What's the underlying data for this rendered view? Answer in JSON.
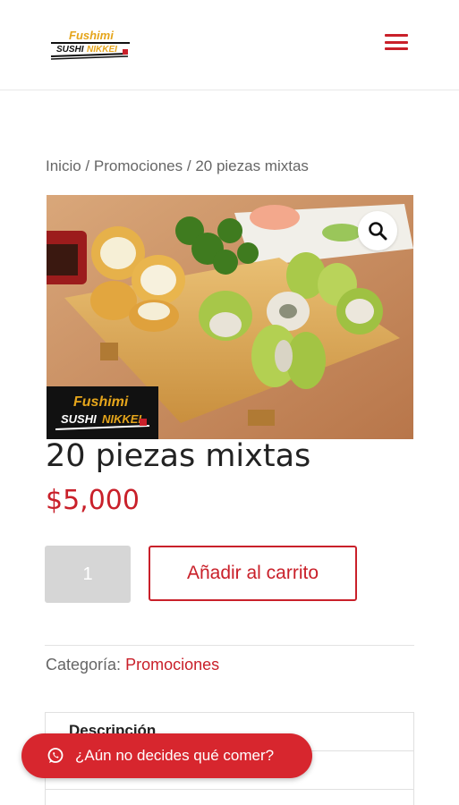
{
  "header": {
    "logo_text_top": "Fushimi",
    "logo_text_bottom": "SUSHI NIKKEI",
    "menu_icon": "hamburger-menu-icon"
  },
  "breadcrumb": {
    "home": "Inicio",
    "separator": "/",
    "category": "Promociones",
    "current": "20 piezas mixtas"
  },
  "product": {
    "title": "20 piezas mixtas",
    "price": "$5,000",
    "zoom_icon": "magnifier-icon",
    "image_watermark_top": "Fushimi",
    "image_watermark_bottom": "SUSHI NIKKEI",
    "quantity": "1",
    "add_to_cart_label": "Añadir al carrito",
    "category_label": "Categoría:",
    "category_value": "Promociones"
  },
  "tabs": {
    "description_label": "Descripción"
  },
  "chat": {
    "icon": "whatsapp-icon",
    "label": "¿Aún no decides qué comer?"
  },
  "colors": {
    "accent": "#c9202a",
    "chat_bg": "#d7262e",
    "qty_bg": "#d6d6d6"
  }
}
